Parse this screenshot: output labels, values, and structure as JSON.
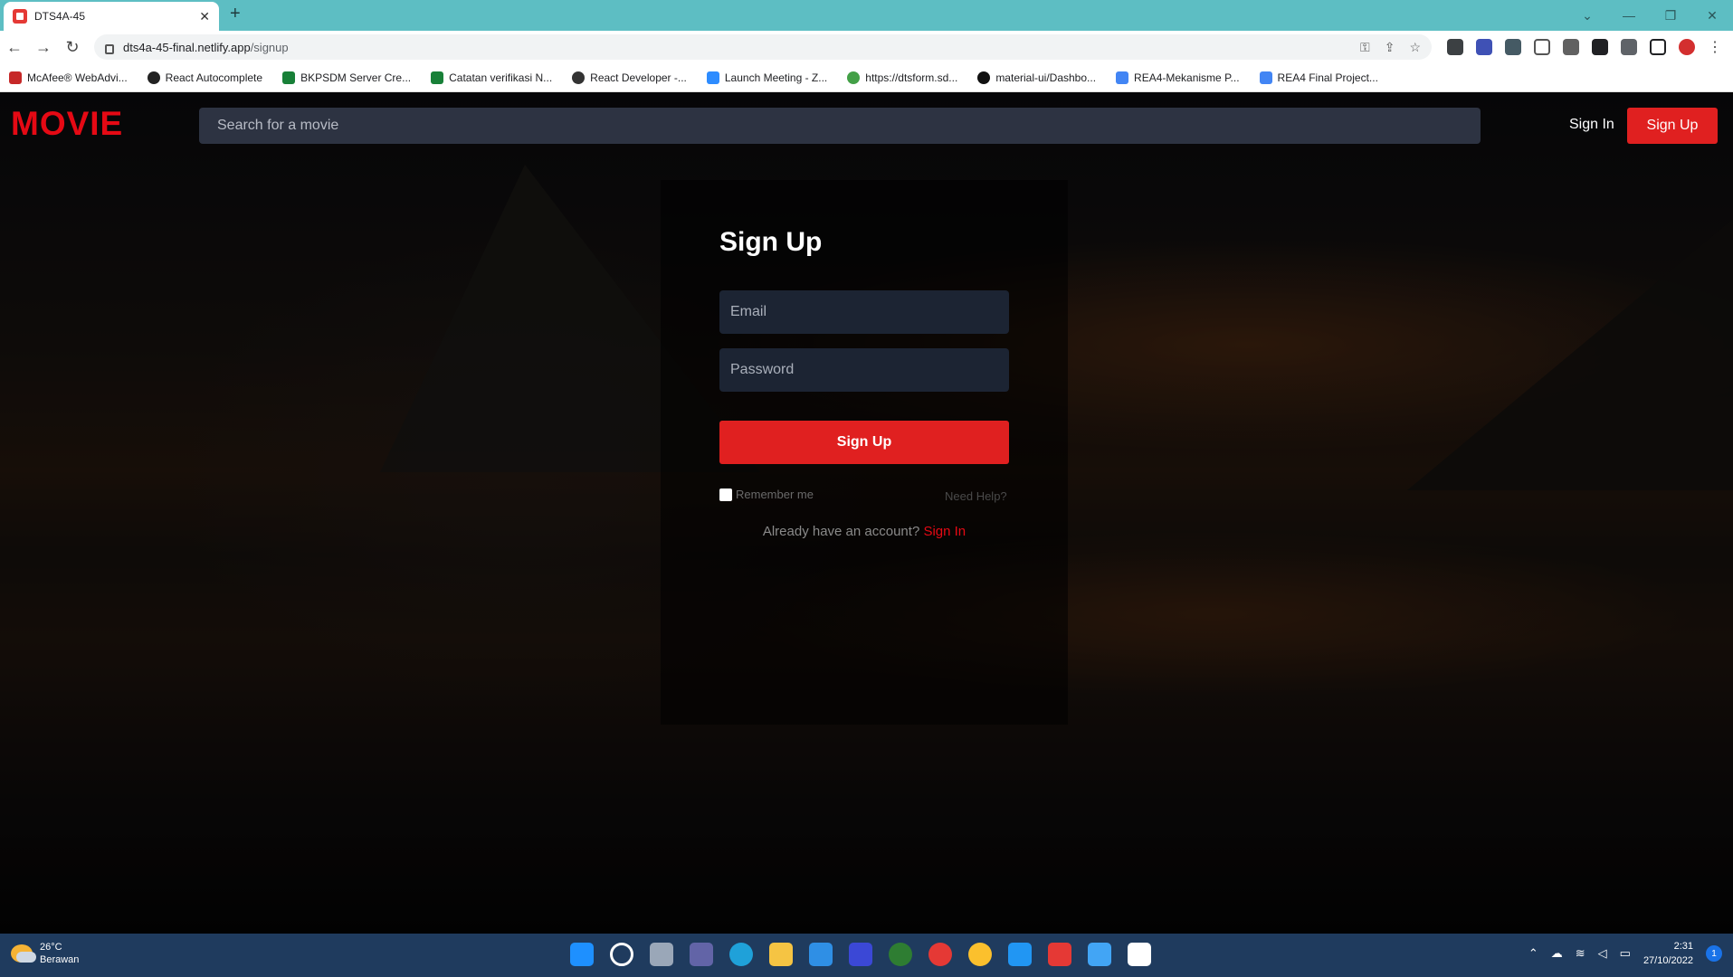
{
  "browser": {
    "tab_title": "DTS4A-45",
    "url_host": "dts4a-45-final.netlify.app",
    "url_path": "/signup",
    "bookmarks": [
      "McAfee® WebAdvi...",
      "React Autocomplete",
      "BKPSDM Server Cre...",
      "Catatan verifikasi N...",
      "React Developer -...",
      "Launch Meeting - Z...",
      "https://dtsform.sd...",
      "material-ui/Dashbo...",
      "REA4-Mekanisme P...",
      "REA4 Final Project..."
    ]
  },
  "nav": {
    "logo": "MOVIE",
    "search_placeholder": "Search for a movie",
    "signin_label": "Sign In",
    "signup_label": "Sign Up"
  },
  "form": {
    "title": "Sign Up",
    "email_placeholder": "Email",
    "password_placeholder": "Password",
    "submit_label": "Sign Up",
    "remember_label": "Remember me",
    "help_label": "Need Help?",
    "already_text": "Already have an account?",
    "signin_link": "Sign In"
  },
  "taskbar": {
    "temperature": "26°C",
    "weather": "Berawan",
    "time": "2:31",
    "date": "27/10/2022",
    "notifications": "1"
  },
  "colors": {
    "brand": "#e50914",
    "button": "#e02020"
  }
}
